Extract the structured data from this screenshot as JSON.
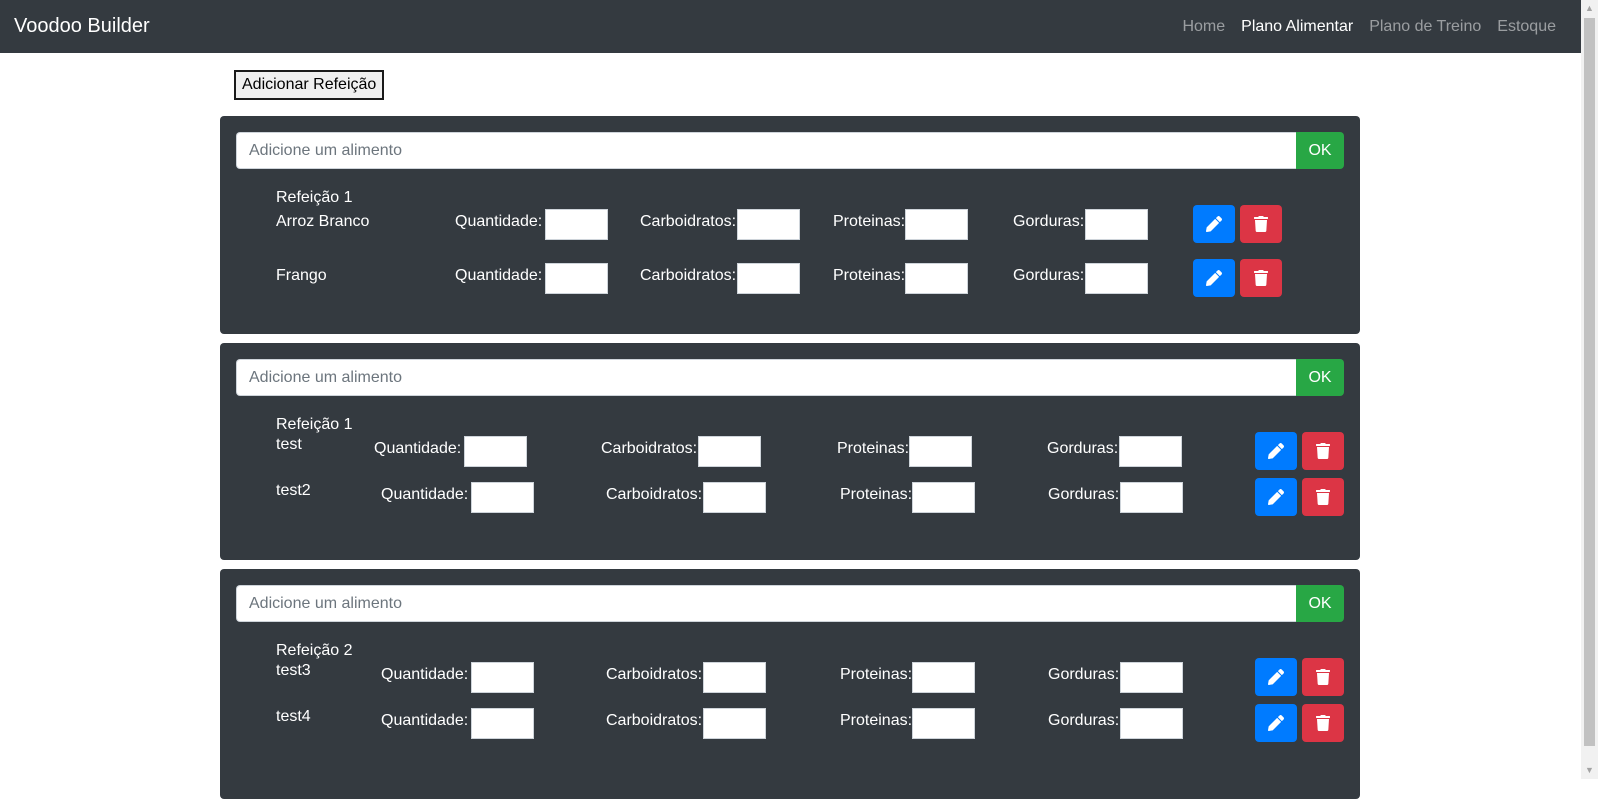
{
  "navbar": {
    "brand": "Voodoo Builder",
    "links": [
      {
        "label": "Home",
        "active": false
      },
      {
        "label": "Plano Alimentar",
        "active": true
      },
      {
        "label": "Plano de Treino",
        "active": false
      },
      {
        "label": "Estoque",
        "active": false
      }
    ]
  },
  "add_meal_label": "Adicionar Refeição",
  "meals": [
    {
      "placeholder": "Adicione um alimento",
      "ok_label": "OK",
      "title": "Refeição 1",
      "foods": [
        {
          "name": "Arroz Branco",
          "quantidade": "",
          "carboidratos": "",
          "proteinas": "",
          "gorduras": ""
        },
        {
          "name": "Frango",
          "quantidade": "",
          "carboidratos": "",
          "proteinas": "",
          "gorduras": ""
        }
      ]
    },
    {
      "placeholder": "Adicione um alimento",
      "ok_label": "OK",
      "title": "Refeição 1",
      "foods": [
        {
          "name": "test",
          "quantidade": "",
          "carboidratos": "",
          "proteinas": "",
          "gorduras": ""
        },
        {
          "name": "test2",
          "quantidade": "",
          "carboidratos": "",
          "proteinas": "",
          "gorduras": ""
        }
      ]
    },
    {
      "placeholder": "Adicione um alimento",
      "ok_label": "OK",
      "title": "Refeição 2",
      "foods": [
        {
          "name": "test3",
          "quantidade": "",
          "carboidratos": "",
          "proteinas": "",
          "gorduras": ""
        },
        {
          "name": "test4",
          "quantidade": "",
          "carboidratos": "",
          "proteinas": "",
          "gorduras": ""
        }
      ]
    }
  ],
  "field_labels": {
    "quantidade": "Quantidade:",
    "carboidratos": "Carboidratos:",
    "proteinas": "Proteinas:",
    "gorduras": "Gorduras:"
  },
  "icons": {
    "edit": "pencil-icon",
    "delete": "trash-icon"
  },
  "colors": {
    "navbar": "#343a40",
    "card": "#343a40",
    "ok_button": "#28a745",
    "edit_button": "#007bff",
    "delete_button": "#dc3545"
  }
}
